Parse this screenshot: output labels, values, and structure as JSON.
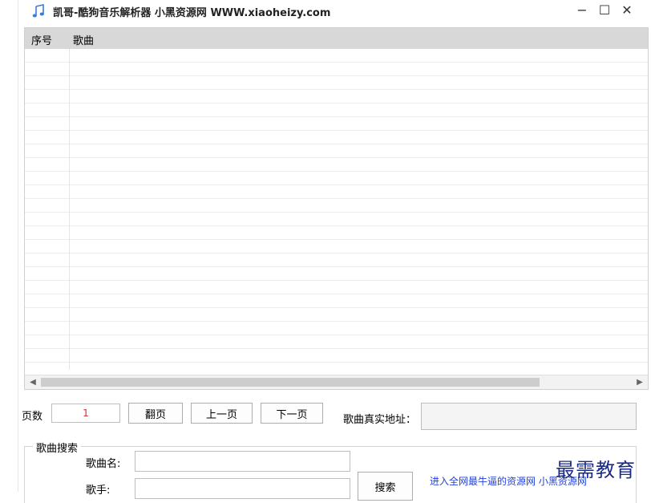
{
  "window": {
    "title": "凯哥-酷狗音乐解析器    小黑资源网 WWW.xiaoheizy.com",
    "minimize": "−",
    "maximize": "☐",
    "close": "✕"
  },
  "table": {
    "columns": [
      "序号",
      "歌曲"
    ],
    "rows": []
  },
  "pager": {
    "pages_label": "页数",
    "page_value": "1",
    "flip_button": "翻页",
    "prev_button": "上一页",
    "next_button": "下一页",
    "real_url_label": "歌曲真实地址：",
    "real_url_value": ""
  },
  "search": {
    "group_title": "歌曲搜索",
    "song_name_label": "歌曲名:",
    "song_name_value": "",
    "singer_label": "歌手:",
    "singer_value": "",
    "search_button": "搜索",
    "link_text": "进入全网最牛逼的资源网  小黑资源网"
  },
  "watermark": "最需教育"
}
